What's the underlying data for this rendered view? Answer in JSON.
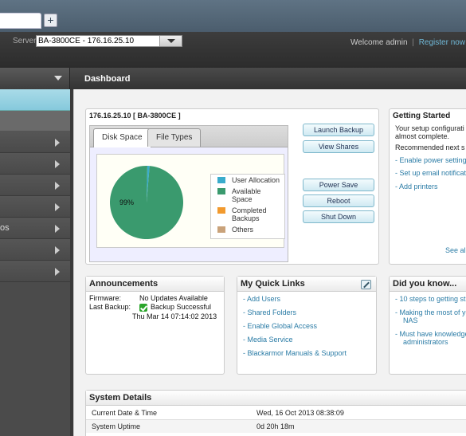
{
  "browser": {
    "new_tab_label": "+"
  },
  "header": {
    "server_label": "Server:",
    "server_value": "BA-3800CE - 176.16.25.10",
    "welcome_text": "Welcome admin",
    "separator": "|",
    "register_link": "Register now"
  },
  "title_bar": {
    "page_title": "Dashboard"
  },
  "sidebar": {
    "items": [
      {
        "label": ""
      },
      {
        "label": ""
      },
      {
        "label": ""
      },
      {
        "label": ""
      },
      {
        "label": "os"
      },
      {
        "label": ""
      },
      {
        "label": ""
      }
    ]
  },
  "server_panel": {
    "title": "176.16.25.10 [ BA-3800CE ]",
    "tabs": [
      "Disk Space",
      "File Types"
    ],
    "active_tab": "Disk Space",
    "buttons": {
      "launch_backup": "Launch Backup",
      "view_shares": "View Shares",
      "power_save": "Power Save",
      "reboot": "Reboot",
      "shut_down": "Shut Down"
    }
  },
  "chart_data": {
    "type": "pie",
    "slices": [
      {
        "label": "User Allocation",
        "value": 1,
        "color": "#3aaccc"
      },
      {
        "label": "Available Space",
        "value": 99,
        "color": "#3a9a6e"
      },
      {
        "label": "Completed Backups",
        "value": 0,
        "color": "#f29a2e"
      },
      {
        "label": "Others",
        "value": 0,
        "color": "#c9a27a"
      }
    ],
    "data_label": "99%"
  },
  "getting_started": {
    "title": "Getting Started",
    "text_lines": [
      "Your setup configurati",
      "almost complete."
    ],
    "recommended": "Recommended next s",
    "links": [
      "Enable power setting",
      "Set up email notificat",
      "Add printers"
    ],
    "see_all": "See all"
  },
  "announcements": {
    "title": "Announcements",
    "firmware_label": "Firmware:",
    "firmware_value": "No Updates Available",
    "last_backup_label": "Last Backup:",
    "last_backup_value": "Backup Successful",
    "last_backup_date": "Thu Mar 14 07:14:02 2013"
  },
  "quick_links": {
    "title": "My Quick Links",
    "links": [
      "Add Users",
      "Shared Folders",
      "Enable Global Access",
      "Media Service",
      "Blackarmor Manuals & Support"
    ]
  },
  "did_you_know": {
    "title": "Did you know...",
    "links": [
      "10 steps to getting st",
      "Making the most of yo",
      "NAS",
      "Must have knowledge",
      "administrators"
    ]
  },
  "system_details": {
    "title": "System Details",
    "rows": [
      {
        "key": "Current Date & Time",
        "value": "Wed, 16 Oct 2013 08:38:09"
      },
      {
        "key": "System Uptime",
        "value": "0d 20h 18m"
      }
    ]
  }
}
